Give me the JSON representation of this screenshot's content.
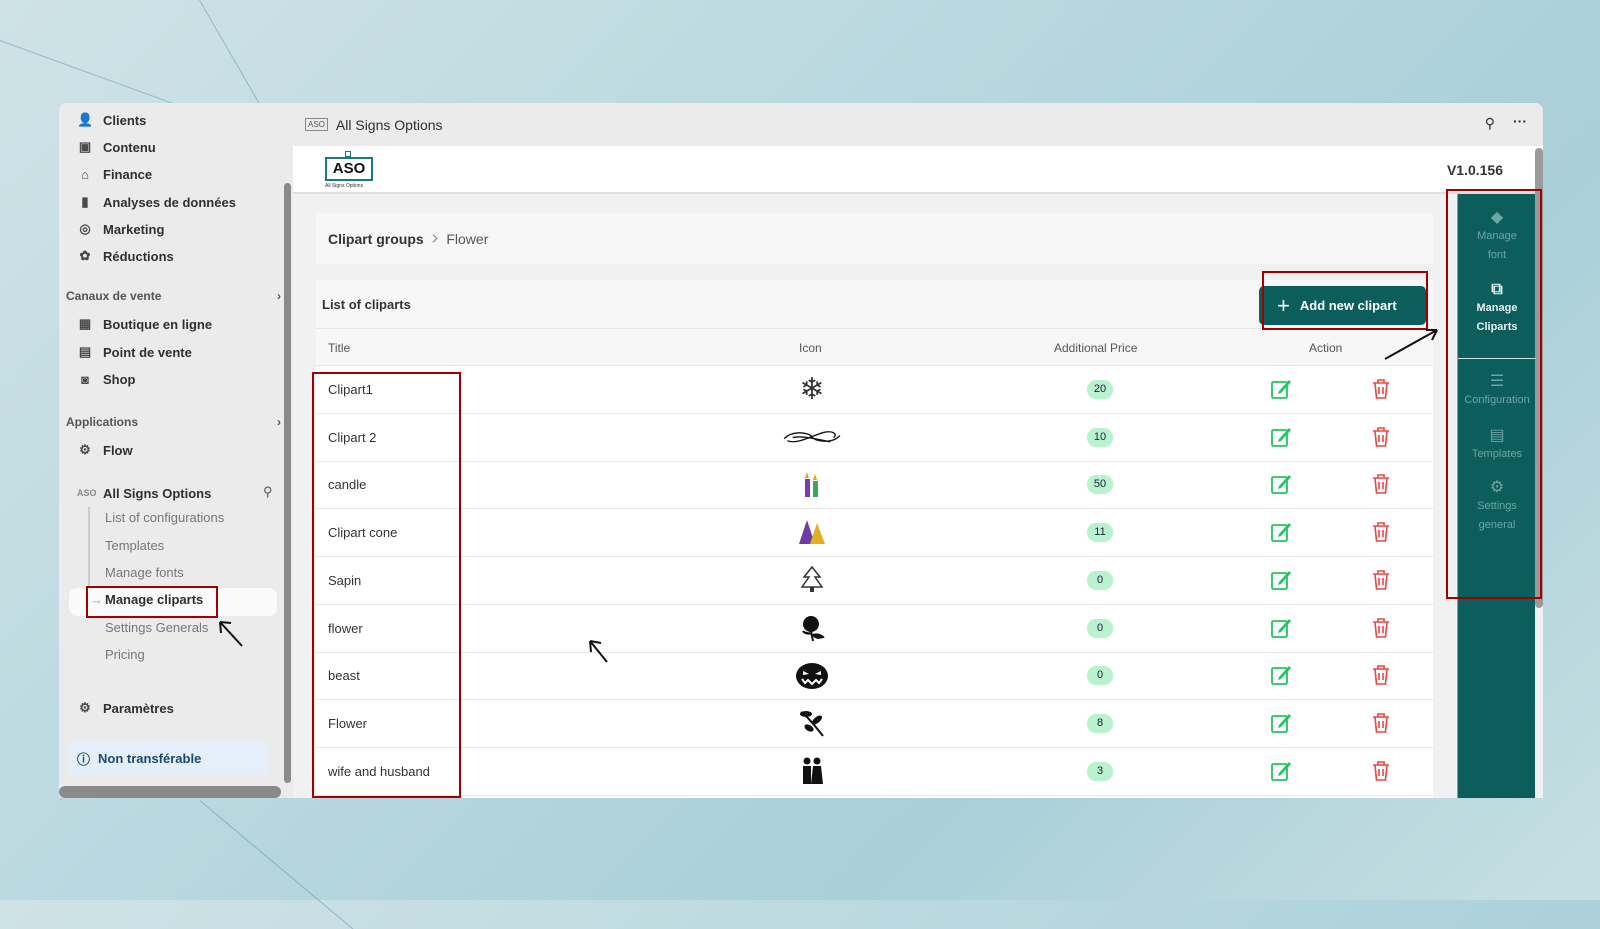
{
  "sidebar": {
    "items": [
      {
        "label": "Clients",
        "icon": "person-icon"
      },
      {
        "label": "Contenu",
        "icon": "content-icon"
      },
      {
        "label": "Finance",
        "icon": "bank-icon"
      },
      {
        "label": "Analyses de données",
        "icon": "bar-chart-icon"
      },
      {
        "label": "Marketing",
        "icon": "target-icon"
      },
      {
        "label": "Réductions",
        "icon": "discount-icon"
      }
    ],
    "sales_section": "Canaux de vente",
    "sales_items": [
      {
        "label": "Boutique en ligne"
      },
      {
        "label": "Point de vente"
      },
      {
        "label": "Shop"
      }
    ],
    "apps_section": "Applications",
    "apps_items": [
      {
        "label": "Flow"
      }
    ],
    "app_name": "All Signs Options",
    "app_subitems": [
      "List of configurations",
      "Templates",
      "Manage fonts",
      "Manage cliparts",
      "Settings Generals",
      "Pricing"
    ],
    "active_subitem": "Manage cliparts",
    "settings": "Paramètres",
    "notice": "Non transférable"
  },
  "topbar": {
    "title": "All Signs Options"
  },
  "header": {
    "logo_text": "ASO",
    "logo_sub": "All Signs Options",
    "version": "V1.0.156"
  },
  "breadcrumb": {
    "parent": "Clipart groups",
    "current": "Flower"
  },
  "list": {
    "title": "List of cliparts",
    "add_button": "Add new clipart",
    "columns": {
      "title": "Title",
      "icon": "Icon",
      "price": "Additional Price",
      "action": "Action"
    },
    "rows": [
      {
        "title": "Clipart1",
        "icon": "snowflake",
        "price": "20"
      },
      {
        "title": "Clipart 2",
        "icon": "swirl",
        "price": "10"
      },
      {
        "title": "candle",
        "icon": "candles",
        "price": "50"
      },
      {
        "title": "Clipart cone",
        "icon": "party-hats",
        "price": "11"
      },
      {
        "title": "Sapin",
        "icon": "christmas-tree",
        "price": "0"
      },
      {
        "title": "flower",
        "icon": "rose",
        "price": "0"
      },
      {
        "title": "beast",
        "icon": "pumpkin-face",
        "price": "0"
      },
      {
        "title": "Flower",
        "icon": "leaf-branch",
        "price": "8"
      },
      {
        "title": "wife and husband",
        "icon": "couple",
        "price": "3"
      }
    ]
  },
  "right_panel": [
    {
      "label1": "Manage",
      "label2": "font",
      "icon": "font-icon"
    },
    {
      "label1": "Manage",
      "label2": "Cliparts",
      "icon": "clipart-icon",
      "active": true
    },
    {
      "label1": "Configuration",
      "label2": "",
      "icon": "sliders-icon"
    },
    {
      "label1": "Templates",
      "label2": "",
      "icon": "template-icon"
    },
    {
      "label1": "Settings",
      "label2": "general",
      "icon": "settings-icon"
    }
  ],
  "colors": {
    "brand": "#0b5e5c",
    "price_badge": "#b8f3cd",
    "edit": "#22c55e",
    "delete": "#ef4444",
    "annotation": "#a00000"
  }
}
